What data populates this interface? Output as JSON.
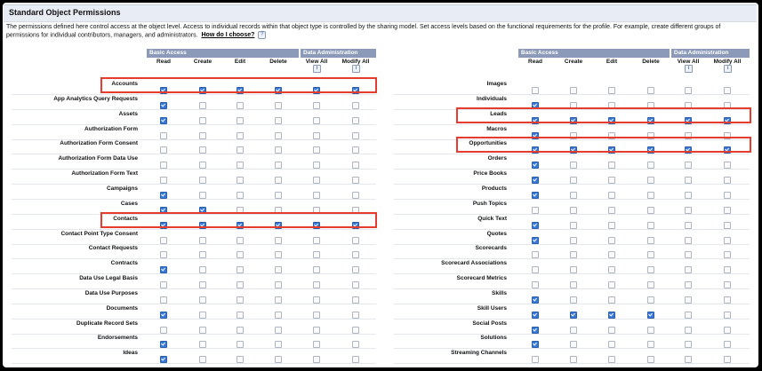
{
  "section": {
    "title": "Standard Object Permissions",
    "description": "The permissions defined here control access at the object level. Access to individual records within that object type is controlled by the sharing model. Set access levels based on the functional requirements for the profile. For example, create different groups of permissions for individual contributors, managers, and administrators.",
    "help_link": "How do I choose?",
    "help_icon": "?"
  },
  "column_groups": {
    "basic": "Basic Access",
    "admin": "Data Administration"
  },
  "columns": [
    "Read",
    "Create",
    "Edit",
    "Delete",
    "View All",
    "Modify All"
  ],
  "info_icon": "i",
  "left_table": [
    {
      "name": "Accounts",
      "perms": [
        1,
        1,
        1,
        1,
        1,
        1
      ],
      "highlighted": true
    },
    {
      "name": "App Analytics Query Requests",
      "perms": [
        1,
        0,
        0,
        0,
        0,
        0
      ]
    },
    {
      "name": "Assets",
      "perms": [
        1,
        0,
        0,
        0,
        0,
        0
      ]
    },
    {
      "name": "Authorization Form",
      "perms": [
        0,
        0,
        0,
        0,
        0,
        0
      ]
    },
    {
      "name": "Authorization Form Consent",
      "perms": [
        0,
        0,
        0,
        0,
        0,
        0
      ]
    },
    {
      "name": "Authorization Form Data Use",
      "perms": [
        0,
        0,
        0,
        0,
        0,
        0
      ]
    },
    {
      "name": "Authorization Form Text",
      "perms": [
        0,
        0,
        0,
        0,
        0,
        0
      ]
    },
    {
      "name": "Campaigns",
      "perms": [
        1,
        0,
        0,
        0,
        0,
        0
      ]
    },
    {
      "name": "Cases",
      "perms": [
        1,
        1,
        0,
        0,
        0,
        0
      ]
    },
    {
      "name": "Contacts",
      "perms": [
        1,
        1,
        1,
        1,
        1,
        1
      ],
      "highlighted": true
    },
    {
      "name": "Contact Point Type Consent",
      "perms": [
        0,
        0,
        0,
        0,
        0,
        0
      ]
    },
    {
      "name": "Contact Requests",
      "perms": [
        0,
        0,
        0,
        0,
        0,
        0
      ]
    },
    {
      "name": "Contracts",
      "perms": [
        1,
        0,
        0,
        0,
        0,
        0
      ]
    },
    {
      "name": "Data Use Legal Basis",
      "perms": [
        0,
        0,
        0,
        0,
        0,
        0
      ]
    },
    {
      "name": "Data Use Purposes",
      "perms": [
        0,
        0,
        0,
        0,
        0,
        0
      ]
    },
    {
      "name": "Documents",
      "perms": [
        1,
        0,
        0,
        0,
        0,
        0
      ]
    },
    {
      "name": "Duplicate Record Sets",
      "perms": [
        0,
        0,
        0,
        0,
        0,
        0
      ]
    },
    {
      "name": "Endorsements",
      "perms": [
        1,
        0,
        0,
        0,
        0,
        0
      ]
    },
    {
      "name": "Ideas",
      "perms": [
        1,
        0,
        0,
        0,
        0,
        0
      ]
    }
  ],
  "right_table": [
    {
      "name": "Images",
      "perms": [
        0,
        0,
        0,
        0,
        0,
        0
      ]
    },
    {
      "name": "Individuals",
      "perms": [
        1,
        0,
        0,
        0,
        0,
        0
      ]
    },
    {
      "name": "Leads",
      "perms": [
        1,
        1,
        1,
        1,
        1,
        1
      ],
      "highlighted": true
    },
    {
      "name": "Macros",
      "perms": [
        1,
        0,
        0,
        0,
        0,
        0
      ]
    },
    {
      "name": "Opportunities",
      "perms": [
        1,
        1,
        1,
        1,
        1,
        1
      ],
      "highlighted": true
    },
    {
      "name": "Orders",
      "perms": [
        1,
        0,
        0,
        0,
        0,
        0
      ]
    },
    {
      "name": "Price Books",
      "perms": [
        1,
        0,
        0,
        0,
        0,
        0
      ]
    },
    {
      "name": "Products",
      "perms": [
        1,
        0,
        0,
        0,
        0,
        0
      ]
    },
    {
      "name": "Push Topics",
      "perms": [
        0,
        0,
        0,
        0,
        0,
        0
      ]
    },
    {
      "name": "Quick Text",
      "perms": [
        1,
        0,
        0,
        0,
        0,
        0
      ]
    },
    {
      "name": "Quotes",
      "perms": [
        1,
        0,
        0,
        0,
        0,
        0
      ]
    },
    {
      "name": "Scorecards",
      "perms": [
        0,
        0,
        0,
        0,
        0,
        0
      ]
    },
    {
      "name": "Scorecard Associations",
      "perms": [
        0,
        0,
        0,
        0,
        0,
        0
      ]
    },
    {
      "name": "Scorecard Metrics",
      "perms": [
        0,
        0,
        0,
        0,
        0,
        0
      ]
    },
    {
      "name": "Skills",
      "perms": [
        1,
        0,
        0,
        0,
        0,
        0
      ]
    },
    {
      "name": "Skill Users",
      "perms": [
        1,
        1,
        1,
        1,
        0,
        0
      ]
    },
    {
      "name": "Social Posts",
      "perms": [
        1,
        0,
        0,
        0,
        0,
        0
      ]
    },
    {
      "name": "Solutions",
      "perms": [
        1,
        0,
        0,
        0,
        0,
        0
      ]
    },
    {
      "name": "Streaming Channels",
      "perms": [
        0,
        0,
        0,
        0,
        0,
        0
      ]
    }
  ]
}
